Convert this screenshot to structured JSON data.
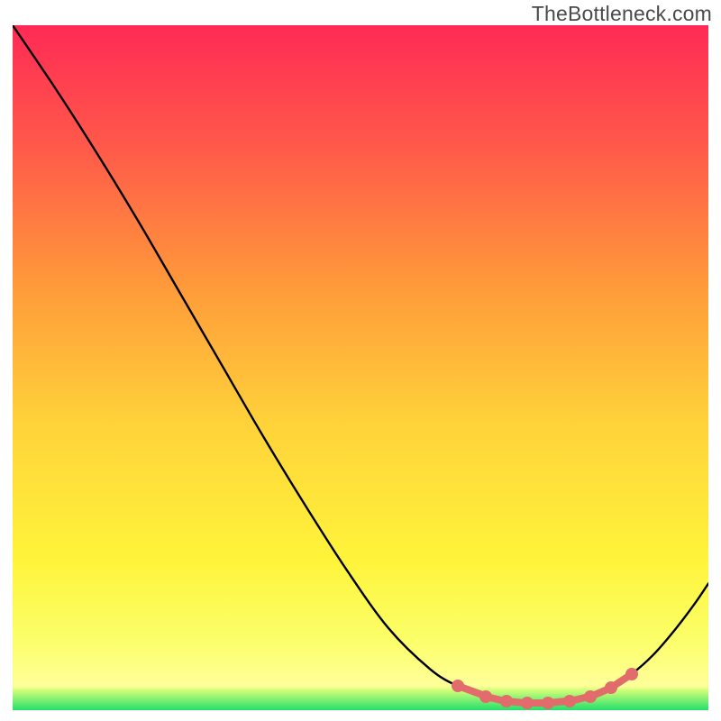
{
  "header": {
    "watermark": "TheBottleneck.com"
  },
  "gradient": {
    "stops": [
      {
        "offset": "0%",
        "color": "#ff2a55"
      },
      {
        "offset": "18%",
        "color": "#ff5a4a"
      },
      {
        "offset": "38%",
        "color": "#ff9a3a"
      },
      {
        "offset": "58%",
        "color": "#ffd23a"
      },
      {
        "offset": "78%",
        "color": "#fff43a"
      },
      {
        "offset": "90%",
        "color": "#fbff6a"
      },
      {
        "offset": "96.5%",
        "color": "#ffff9a"
      },
      {
        "offset": "97%",
        "color": "#d6ff7a"
      },
      {
        "offset": "100%",
        "color": "#23e06b"
      }
    ]
  },
  "chart_data": {
    "type": "line",
    "title": "",
    "xlabel": "",
    "ylabel": "",
    "xlim": [
      0,
      100
    ],
    "ylim": [
      0,
      100
    ],
    "x": [
      0,
      6,
      12,
      18,
      24,
      30,
      36,
      42,
      48,
      54,
      60,
      64,
      68,
      71,
      74,
      77,
      80,
      83,
      86,
      89,
      92,
      95,
      98,
      100
    ],
    "y": [
      100,
      91,
      81.5,
      71.5,
      61,
      50.5,
      40,
      30,
      20.5,
      12,
      6,
      3.5,
      2,
      1.3,
      1,
      1,
      1.3,
      2,
      3.3,
      5.3,
      8,
      11.5,
      15.5,
      18.5
    ],
    "markers_x": [
      64,
      68,
      71,
      74,
      77,
      80,
      83,
      86,
      89
    ],
    "markers_y": [
      3.5,
      2,
      1.3,
      1,
      1,
      1.3,
      2,
      3.3,
      5.3
    ],
    "marker_color": "#e26b6b",
    "line_color": "#000000"
  }
}
